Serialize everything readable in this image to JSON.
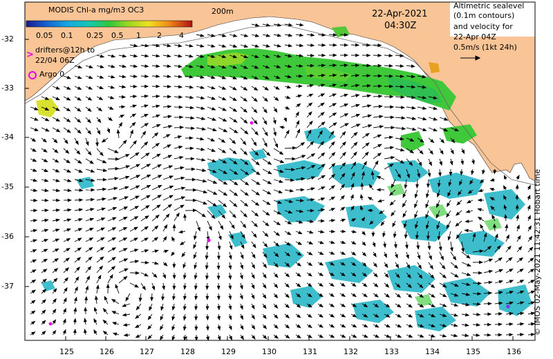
{
  "map": {
    "colorbar_title": "MODIS Chl-a mg/m3 OC3",
    "colorbar_ticks": [
      "0.05",
      "0.1",
      "0.25",
      "0.5",
      "1",
      "2",
      "4"
    ],
    "isobath_label": "200m",
    "date": "22-Apr-2021",
    "time": "04:30Z",
    "drifters_line1": "drifters@12h to",
    "drifters_line2": "22/04 06Z",
    "drifters_symbol": ">",
    "argo_label": "Argo 0",
    "legend_lines": [
      "Altimetric sealevel",
      "(0.1m contours)",
      "and velocity for",
      "22-Apr 04Z",
      "0.5m/s (1kt 24h)"
    ],
    "copyright": "© IMOS 02-May-2021 11:42:31 Hobart time",
    "lat_labels": [
      "-32",
      "-33",
      "-34",
      "-35",
      "-36",
      "-37"
    ],
    "lon_labels": [
      "125",
      "126",
      "127",
      "128",
      "129",
      "130",
      "131",
      "132",
      "133",
      "134",
      "135",
      "136"
    ],
    "colors": {
      "land": "#f9c597",
      "ocean": "#ffffff",
      "drifter": "#e800e8",
      "arrow": "#000000"
    }
  }
}
